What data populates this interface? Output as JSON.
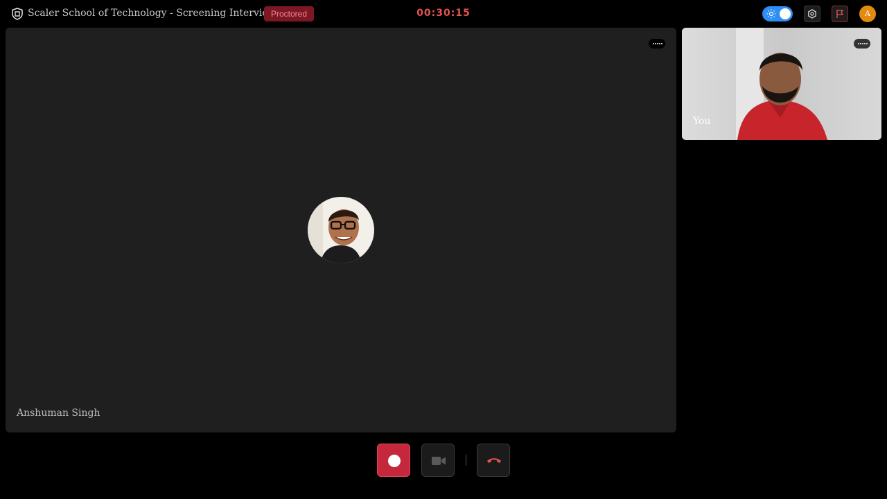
{
  "header": {
    "title": "Scaler School of Technology - Screening Interview",
    "badge": "Proctored",
    "timer": "00:30:15",
    "avatar_initial": "A",
    "theme_toggle": "on"
  },
  "icons": {
    "logo": "shield-logo-icon",
    "theme": "sun-icon",
    "settings": "settings-hex-icon",
    "flag": "flag-icon",
    "more": "more-dots-icon",
    "record": "record-icon",
    "camera": "video-camera-icon",
    "hangup": "phone-hangup-icon"
  },
  "main_tile": {
    "participant_name": "Anshuman Singh"
  },
  "self_tile": {
    "label": "You"
  },
  "colors": {
    "accent_toggle": "#2f8ef5",
    "badge_bg": "#7d1724",
    "timer": "#e5554f",
    "record": "#c5283c",
    "avatar": "#e38b10"
  }
}
